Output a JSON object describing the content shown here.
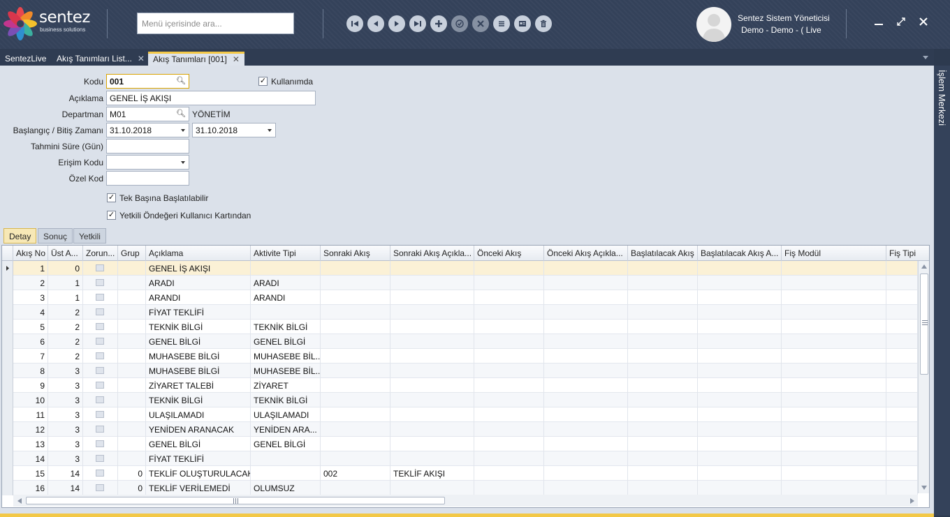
{
  "brand": {
    "name": "sentez",
    "tagline": "business solutions"
  },
  "search": {
    "placeholder": "Menü içerisinde ara..."
  },
  "toolbar": {
    "buttons": [
      "first-icon",
      "prev-icon",
      "next-icon",
      "last-icon",
      "add-icon",
      "approve-icon",
      "cancel-icon",
      "list-icon",
      "card-icon",
      "delete-icon"
    ]
  },
  "user": {
    "name": "Sentez Sistem Yöneticisi",
    "context": "Demo - Demo - ( Live"
  },
  "tabs": [
    {
      "label": "SentezLive",
      "closable": false
    },
    {
      "label": "Akış Tanımları List...",
      "closable": true
    },
    {
      "label": "Akış Tanımları [001]",
      "closable": true,
      "active": true
    }
  ],
  "side_panel": {
    "label": "İşlem Merkezi"
  },
  "form": {
    "kodu_label": "Kodu",
    "kodu_value": "001",
    "kullanimda_label": "Kullanımda",
    "kullanimda_checked": true,
    "aciklama_label": "Açıklama",
    "aciklama_value": "GENEL İŞ AKIŞI",
    "departman_label": "Departman",
    "departman_value": "M01",
    "departman_desc": "YÖNETİM",
    "tarih_label": "Başlangıç / Bitiş Zamanı",
    "baslangic_value": "31.10.2018",
    "bitis_value": "31.10.2018",
    "sure_label": "Tahmini Süre (Gün)",
    "sure_value": "",
    "erisim_label": "Erişim Kodu",
    "erisim_value": "",
    "ozel_label": "Özel Kod",
    "ozel_value": "",
    "tek_basina_label": "Tek Başına Başlatılabilir",
    "tek_basina_checked": true,
    "yetkili_label": "Yetkili Öndeğeri Kullanıcı Kartından",
    "yetkili_checked": true
  },
  "subtabs": [
    "Detay",
    "Sonuç",
    "Yetkili"
  ],
  "grid": {
    "columns": [
      "Akış No",
      "Üst A...",
      "Zorun...",
      "Grup",
      "Açıklama",
      "Aktivite Tipi",
      "Sonraki Akış",
      "Sonraki Akış Açıkla...",
      "Önceki Akış",
      "Önceki Akış Açıkla...",
      "Başlatılacak Akış",
      "Başlatılacak Akış A...",
      "Fiş Modül",
      "Fiş Tipi"
    ],
    "rows": [
      {
        "akis_no": "1",
        "ust": "0",
        "grup": "",
        "aciklama": "GENEL İŞ AKIŞI",
        "aktivite": "",
        "sonraki": "",
        "sonraki_acik": ""
      },
      {
        "akis_no": "2",
        "ust": "1",
        "grup": "",
        "aciklama": "ARADI",
        "aktivite": "ARADI",
        "sonraki": "",
        "sonraki_acik": ""
      },
      {
        "akis_no": "3",
        "ust": "1",
        "grup": "",
        "aciklama": "ARANDI",
        "aktivite": "ARANDI",
        "sonraki": "",
        "sonraki_acik": ""
      },
      {
        "akis_no": "4",
        "ust": "2",
        "grup": "",
        "aciklama": "FİYAT TEKLİFİ",
        "aktivite": "",
        "sonraki": "",
        "sonraki_acik": ""
      },
      {
        "akis_no": "5",
        "ust": "2",
        "grup": "",
        "aciklama": "TEKNİK BİLGİ",
        "aktivite": "TEKNİK BİLGİ",
        "sonraki": "",
        "sonraki_acik": ""
      },
      {
        "akis_no": "6",
        "ust": "2",
        "grup": "",
        "aciklama": "GENEL BİLGİ",
        "aktivite": "GENEL BİLGİ",
        "sonraki": "",
        "sonraki_acik": ""
      },
      {
        "akis_no": "7",
        "ust": "2",
        "grup": "",
        "aciklama": "MUHASEBE BİLGİ",
        "aktivite": "MUHASEBE BİL...",
        "sonraki": "",
        "sonraki_acik": ""
      },
      {
        "akis_no": "8",
        "ust": "3",
        "grup": "",
        "aciklama": "MUHASEBE BİLGİ",
        "aktivite": "MUHASEBE BİL...",
        "sonraki": "",
        "sonraki_acik": ""
      },
      {
        "akis_no": "9",
        "ust": "3",
        "grup": "",
        "aciklama": "ZİYARET TALEBİ",
        "aktivite": "ZİYARET",
        "sonraki": "",
        "sonraki_acik": ""
      },
      {
        "akis_no": "10",
        "ust": "3",
        "grup": "",
        "aciklama": "TEKNİK BİLGİ",
        "aktivite": "TEKNİK BİLGİ",
        "sonraki": "",
        "sonraki_acik": ""
      },
      {
        "akis_no": "11",
        "ust": "3",
        "grup": "",
        "aciklama": "ULAŞILAMADI",
        "aktivite": "ULAŞILAMADI",
        "sonraki": "",
        "sonraki_acik": ""
      },
      {
        "akis_no": "12",
        "ust": "3",
        "grup": "",
        "aciklama": "YENİDEN ARANACAK",
        "aktivite": "YENİDEN ARA...",
        "sonraki": "",
        "sonraki_acik": ""
      },
      {
        "akis_no": "13",
        "ust": "3",
        "grup": "",
        "aciklama": "GENEL BİLGİ",
        "aktivite": "GENEL BİLGİ",
        "sonraki": "",
        "sonraki_acik": ""
      },
      {
        "akis_no": "14",
        "ust": "3",
        "grup": "",
        "aciklama": "FİYAT TEKLİFİ",
        "aktivite": "",
        "sonraki": "",
        "sonraki_acik": ""
      },
      {
        "akis_no": "15",
        "ust": "14",
        "grup": "0",
        "aciklama": "TEKLİF OLUŞTURULACAK",
        "aktivite": "",
        "sonraki": "002",
        "sonraki_acik": "TEKLİF AKIŞI"
      },
      {
        "akis_no": "16",
        "ust": "14",
        "grup": "0",
        "aciklama": "TEKLİF VERİLEMEDİ",
        "aktivite": "OLUMSUZ",
        "sonraki": "",
        "sonraki_acik": ""
      }
    ]
  }
}
